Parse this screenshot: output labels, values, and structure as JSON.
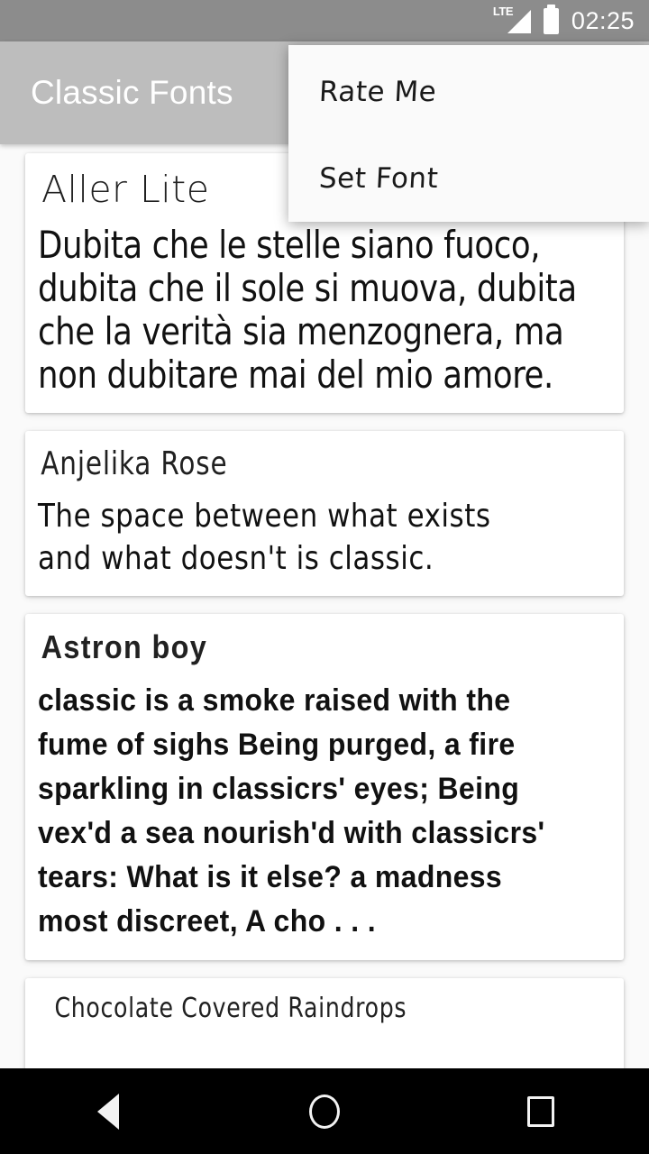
{
  "status_bar": {
    "network_label": "LTE",
    "signal_icon": "signal-triangle-icon",
    "battery_icon": "battery-full-icon",
    "time": "02:25",
    "background_color": "#8c8c8c"
  },
  "app_bar": {
    "title": "Classic Fonts",
    "background_color": "#bdbdbd",
    "title_color": "#ffffff"
  },
  "overflow_menu": {
    "visible": true,
    "items": [
      {
        "label": "Rate Me"
      },
      {
        "label": "Set Font"
      }
    ],
    "background_color": "#fafafa"
  },
  "font_list": {
    "cards": [
      {
        "name": "Aller Lite",
        "sample": "Dubita che le stelle siano fuoco, dubita che il sole si muova, dubita che la verità sia menzognera, ma non dubitare mai del mio amore."
      },
      {
        "name": "Anjelika Rose",
        "sample": "The space between what exists and what doesn't is classic."
      },
      {
        "name": "Astron boy",
        "sample": "classic is a smoke raised with the fume of sighs Being purged, a fire sparkling in classicrs' eyes; Being vex'd a sea nourish'd with classicrs' tears: What is it else? a madness most discreet, A cho . . ."
      },
      {
        "name": "Chocolate Covered Raindrops",
        "sample": ""
      }
    ]
  },
  "nav_bar": {
    "back_label": "back-triangle-icon",
    "home_label": "home-circle-icon",
    "recents_label": "recents-square-icon",
    "background_color": "#000000"
  }
}
